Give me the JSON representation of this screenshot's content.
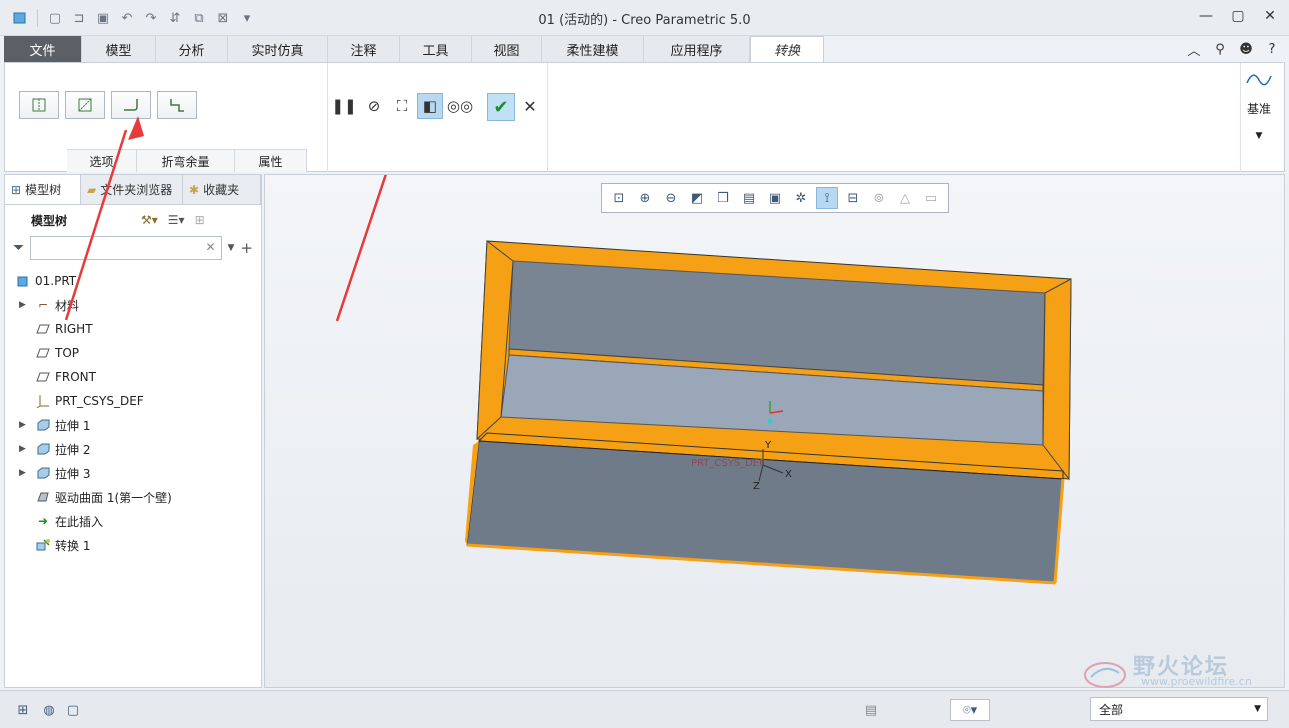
{
  "window": {
    "title": "01 (活动的) - Creo Parametric 5.0"
  },
  "ribbon": {
    "tabs": [
      "文件",
      "模型",
      "分析",
      "实时仿真",
      "注释",
      "工具",
      "视图",
      "柔性建模",
      "应用程序",
      "转换"
    ],
    "subtabs": [
      "选项",
      "折弯余量",
      "属性"
    ],
    "datum_label": "基准"
  },
  "model_tree": {
    "panel_tabs": [
      "模型树",
      "文件夹浏览器",
      "收藏夹"
    ],
    "toolbar_label": "模型树",
    "filter_placeholder": "",
    "nodes": [
      {
        "label": "01.PRT",
        "icon": "part-icon"
      },
      {
        "label": "材料",
        "icon": "material-icon"
      },
      {
        "label": "RIGHT",
        "icon": "datum-plane-icon"
      },
      {
        "label": "TOP",
        "icon": "datum-plane-icon"
      },
      {
        "label": "FRONT",
        "icon": "datum-plane-icon"
      },
      {
        "label": "PRT_CSYS_DEF",
        "icon": "csys-icon"
      },
      {
        "label": "拉伸 1",
        "icon": "extrude-icon"
      },
      {
        "label": "拉伸 2",
        "icon": "extrude-icon"
      },
      {
        "label": "拉伸 3",
        "icon": "extrude-icon"
      },
      {
        "label": "驱动曲面 1(第一个壁)",
        "icon": "driving-surface-icon"
      },
      {
        "label": "在此插入",
        "icon": "insert-here-icon"
      },
      {
        "label": "转换 1",
        "icon": "conversion-icon"
      }
    ]
  },
  "viewport": {
    "csys_label": "PRT_CSYS_DEF",
    "axis_x": "X",
    "axis_y": "Y",
    "axis_z": "Z"
  },
  "watermark": {
    "text": "野火论坛",
    "url": "www.proewildfire.cn"
  },
  "statusbar": {
    "filter_value": "全部"
  },
  "colors": {
    "model_edge": "#f5a015",
    "model_face": "#7a8594",
    "model_face_light": "#9aa7b8",
    "annotation_arrow": "#e83a3a"
  }
}
